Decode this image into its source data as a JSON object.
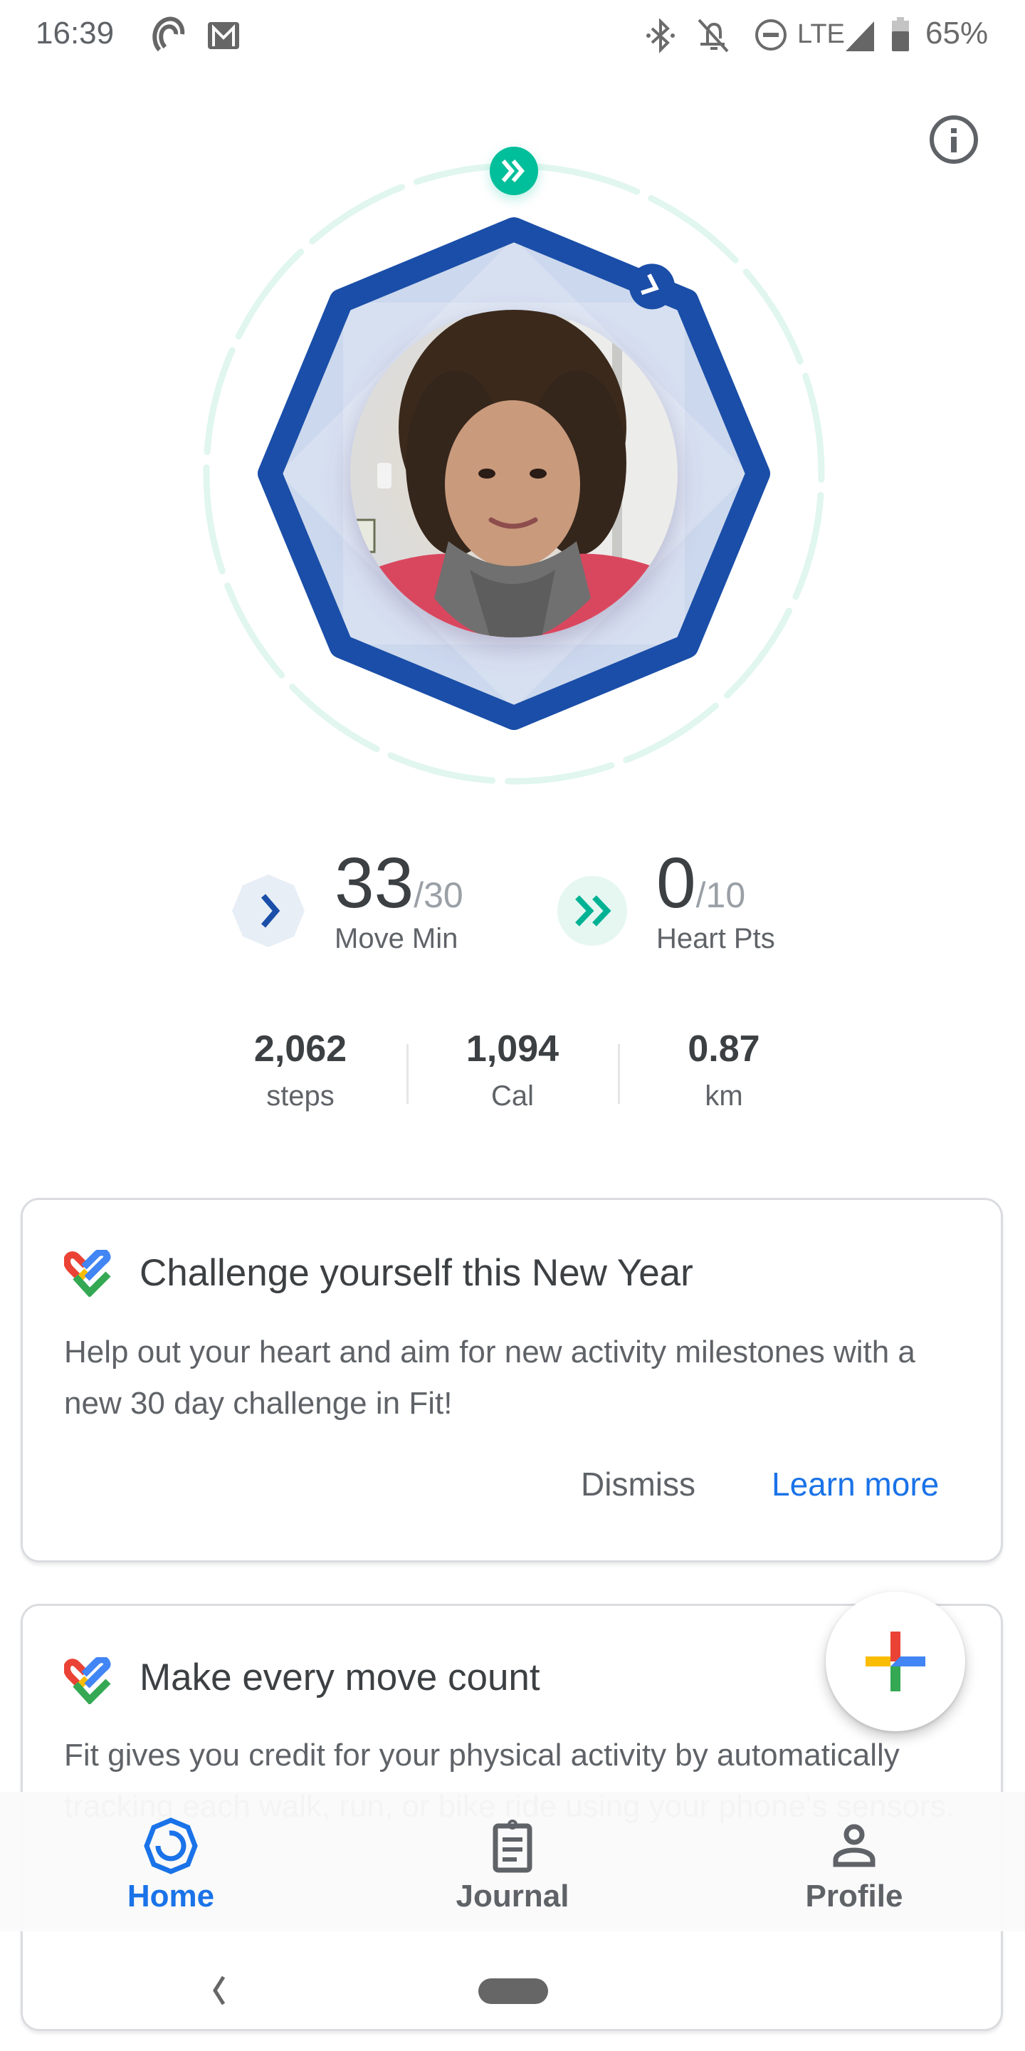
{
  "status_bar": {
    "time": "16:39",
    "left_icons": [
      "sync-icon",
      "gmail-icon"
    ],
    "right_icons": [
      "bluetooth-icon",
      "alarm-off-icon",
      "do-not-disturb-icon",
      "lte-label",
      "signal-icon",
      "battery-icon"
    ],
    "network": "LTE",
    "battery_percent": "65%"
  },
  "header": {
    "info_icon": "info-icon"
  },
  "ring": {
    "avatar_alt": "Profile photo",
    "move_min_progress": 1.1,
    "heart_pts_progress": 0.0,
    "colors": {
      "move_min": "#1a4ea8",
      "heart_pts": "#00bf9a",
      "heart_track": "#e0f6ef"
    }
  },
  "goals": {
    "move_min": {
      "value": "33",
      "target": "/30",
      "label": "Move Min",
      "icon": "move-min-chevron-icon"
    },
    "heart_pts": {
      "value": "0",
      "target": "/10",
      "label": "Heart Pts",
      "icon": "heart-pts-double-chevron-icon"
    }
  },
  "metrics": [
    {
      "value": "2,062",
      "unit": "steps"
    },
    {
      "value": "1,094",
      "unit": "Cal"
    },
    {
      "value": "0.87",
      "unit": "km"
    }
  ],
  "cards": [
    {
      "title": "Challenge yourself this New Year",
      "body": "Help out your heart and aim for new activity milestones with a new 30 day challenge in Fit!",
      "dismiss_label": "Dismiss",
      "learn_more_label": "Learn more"
    },
    {
      "title": "Make every move count",
      "body": "Fit gives you credit for your physical activity by automatically tracking each walk, run, or bike ride using your phone's sensors."
    }
  ],
  "fab": {
    "icon": "add-icon"
  },
  "bottom_nav": {
    "items": [
      {
        "label": "Home",
        "icon": "home-icon",
        "active": true
      },
      {
        "label": "Journal",
        "icon": "journal-icon",
        "active": false
      },
      {
        "label": "Profile",
        "icon": "profile-icon",
        "active": false
      }
    ]
  }
}
